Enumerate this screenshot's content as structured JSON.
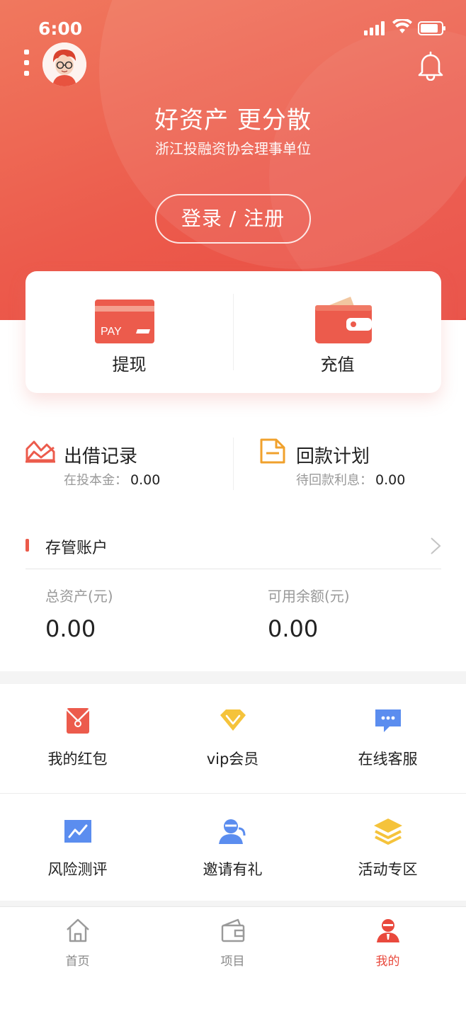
{
  "status_bar": {
    "time": "6:00"
  },
  "header": {
    "title": "好资产 更分散",
    "subtitle": "浙江投融资协会理事单位",
    "login_label": "登录 / 注册"
  },
  "pay_card": {
    "withdraw": {
      "label": "提现",
      "card_text": "PAY",
      "icon": "pay-card-icon"
    },
    "recharge": {
      "label": "充值",
      "icon": "wallet-icon"
    }
  },
  "records": {
    "loan": {
      "title": "出借记录",
      "sub_label": "在投本金：",
      "value": "0.00",
      "icon": "trend-chart-icon"
    },
    "repay": {
      "title": "回款计划",
      "sub_label": "待回款利息：",
      "value": "0.00",
      "icon": "document-icon"
    }
  },
  "custody": {
    "title": "存管账户",
    "total_label": "总资产(元)",
    "total_value": "0.00",
    "available_label": "可用余额(元)",
    "available_value": "0.00"
  },
  "grid": [
    {
      "label": "我的红包",
      "icon": "red-envelope-icon"
    },
    {
      "label": "vip会员",
      "icon": "diamond-icon"
    },
    {
      "label": "在线客服",
      "icon": "chat-bubble-icon"
    },
    {
      "label": "风险测评",
      "icon": "risk-chart-icon"
    },
    {
      "label": "邀请有礼",
      "icon": "invite-user-icon"
    },
    {
      "label": "活动专区",
      "icon": "layers-icon"
    }
  ],
  "tabbar": [
    {
      "label": "首页",
      "icon": "home-icon"
    },
    {
      "label": "项目",
      "icon": "wallet-outline-icon"
    },
    {
      "label": "我的",
      "icon": "profile-icon",
      "active": true
    }
  ],
  "colors": {
    "brand_red": "#ec5b4c",
    "active_tab": "#e9493d",
    "vip_gold": "#f5c33b",
    "chat_blue": "#5b8def"
  }
}
